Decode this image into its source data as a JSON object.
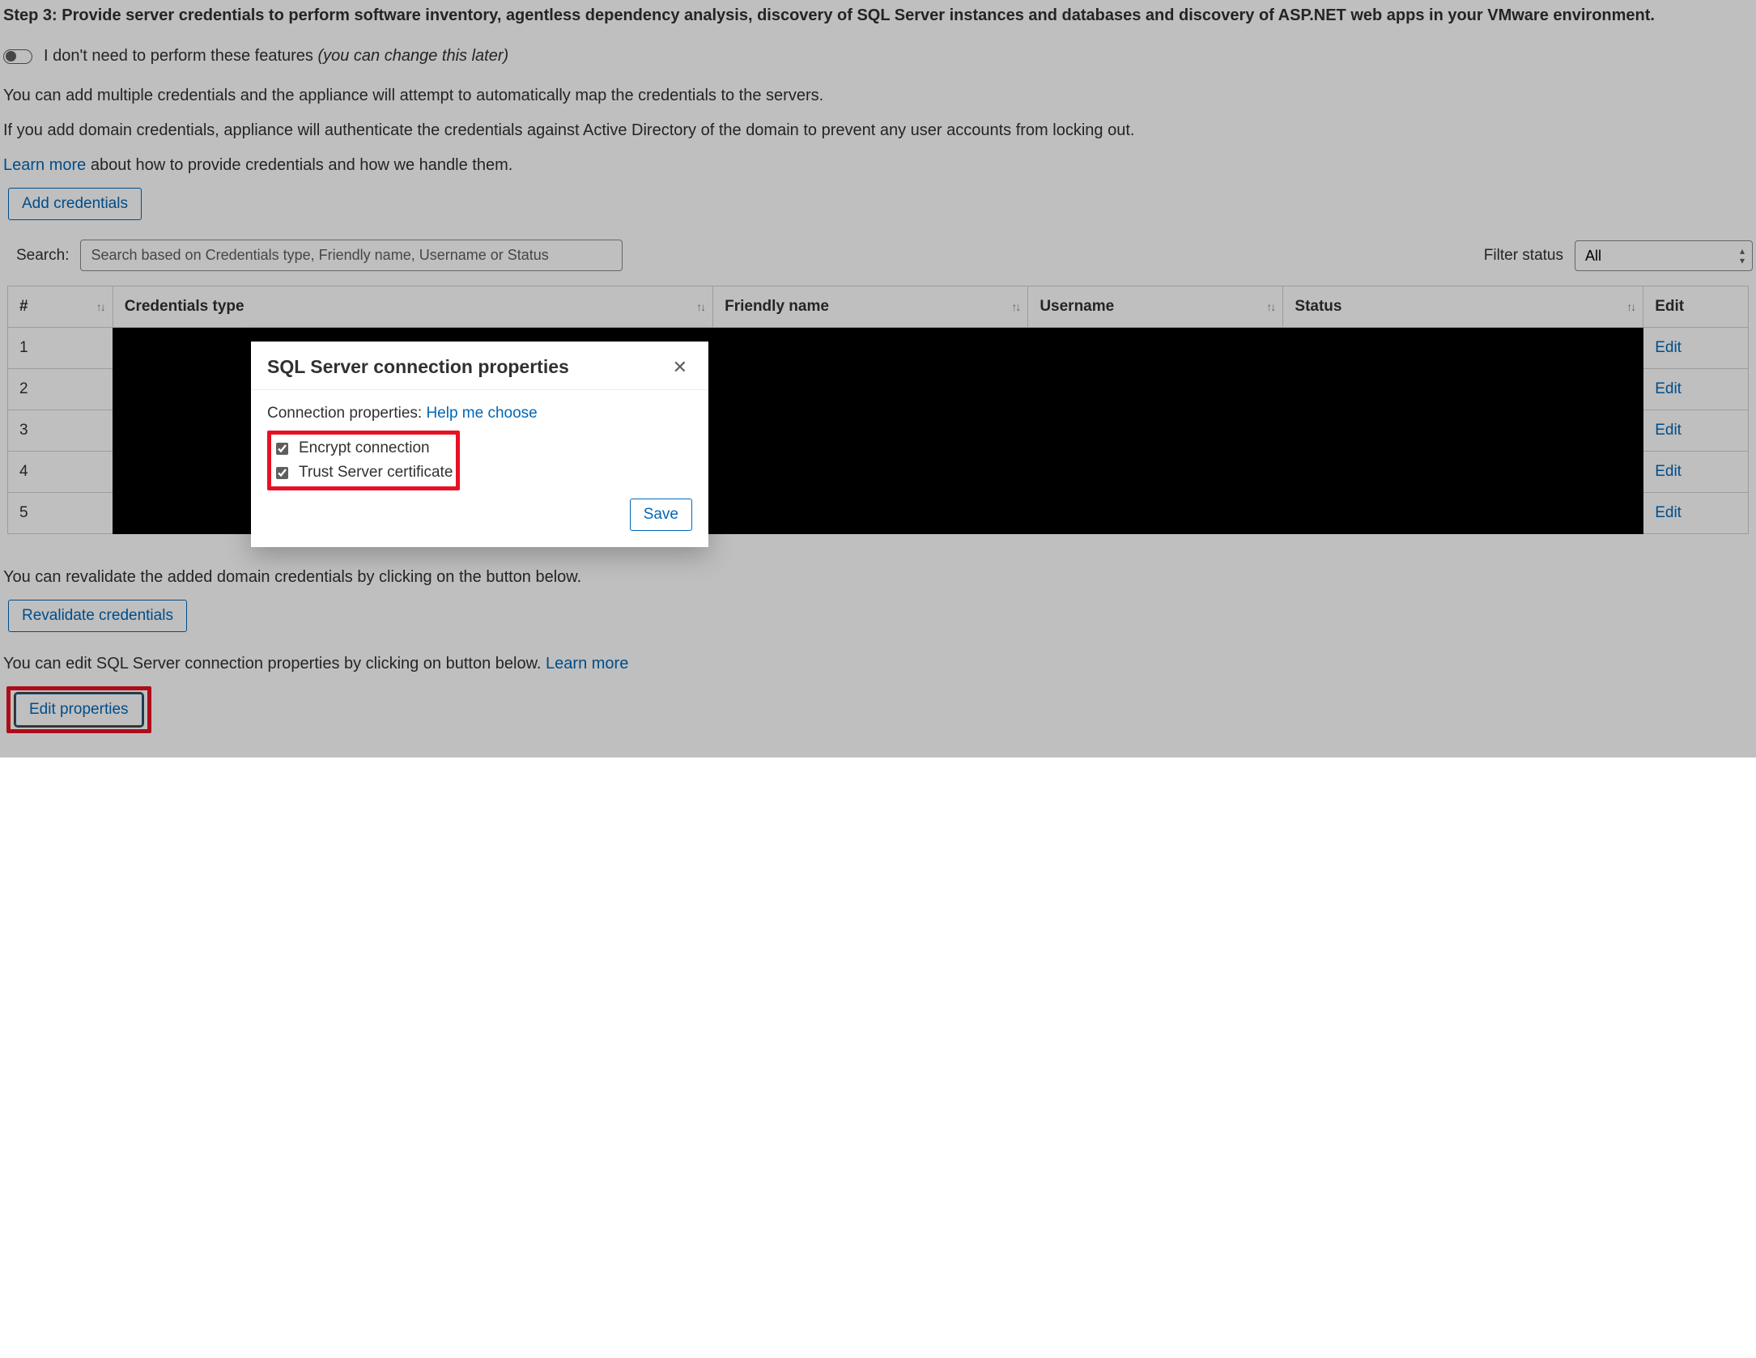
{
  "step_heading": "Step 3: Provide server credentials to perform software inventory, agentless dependency analysis, discovery of SQL Server instances and databases and discovery of ASP.NET web apps in your VMware environment.",
  "toggle": {
    "label": "I don't need to perform these features ",
    "hint": "(you can change this later)"
  },
  "intro": {
    "p1": "You can add multiple credentials and the appliance will attempt to automatically map the credentials to the servers.",
    "p2": "If you add domain credentials, appliance will authenticate the credentials against Active Directory of the domain to prevent any user accounts from locking out.",
    "learn_more": "Learn more",
    "learn_more_after": " about how to provide credentials and how we handle them."
  },
  "buttons": {
    "add_credentials": "Add credentials",
    "revalidate": "Revalidate credentials",
    "edit_properties": "Edit properties",
    "save": "Save"
  },
  "search": {
    "label": "Search:",
    "placeholder": "Search based on Credentials type, Friendly name, Username or Status"
  },
  "filter": {
    "label": "Filter status",
    "value": "All"
  },
  "table": {
    "cols": {
      "idx": "#",
      "type": "Credentials type",
      "friendly": "Friendly name",
      "user": "Username",
      "status": "Status",
      "edit": "Edit"
    },
    "rows": [
      {
        "idx": "1",
        "edit": "Edit"
      },
      {
        "idx": "2",
        "edit": "Edit"
      },
      {
        "idx": "3",
        "edit": "Edit"
      },
      {
        "idx": "4",
        "edit": "Edit"
      },
      {
        "idx": "5",
        "edit": "Edit"
      }
    ]
  },
  "below": {
    "revalidate_text": "You can revalidate the added domain credentials by clicking on the button below.",
    "edit_props_text": "You can edit SQL Server connection properties by clicking on button below. ",
    "edit_props_learn_more": "Learn more"
  },
  "modal": {
    "title": "SQL Server connection properties",
    "conn_props_label": "Connection properties: ",
    "help_me_choose": "Help me choose",
    "encrypt": "Encrypt connection",
    "trust": "Trust Server certificate"
  }
}
